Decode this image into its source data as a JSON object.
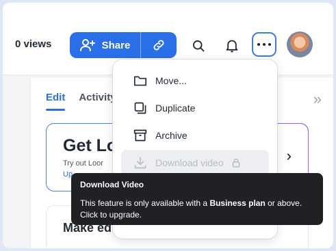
{
  "header": {
    "views": "0 views",
    "share_label": "Share"
  },
  "tabs": [
    {
      "label": "Edit"
    },
    {
      "label": "Activity"
    }
  ],
  "card1": {
    "title": "Get Lo",
    "subtitle": "Try out Loor",
    "link": "Up"
  },
  "card2": {
    "title": "Make ed"
  },
  "menu": {
    "items": [
      {
        "label": "Move...",
        "icon": "folder-icon"
      },
      {
        "label": "Duplicate",
        "icon": "duplicate-icon"
      },
      {
        "label": "Archive",
        "icon": "archive-icon"
      },
      {
        "label": "Download video",
        "icon": "download-icon",
        "disabled": true
      }
    ]
  },
  "tooltip": {
    "title": "Download Video",
    "body_pre": "This feature is only available with a ",
    "body_bold": "Business plan",
    "body_post": " or above.",
    "body_line2": "Click to upgrade."
  },
  "colors": {
    "accent": "#2a6ee8",
    "tooltip_bg": "#202124",
    "page_bg": "#dfe7f7"
  }
}
